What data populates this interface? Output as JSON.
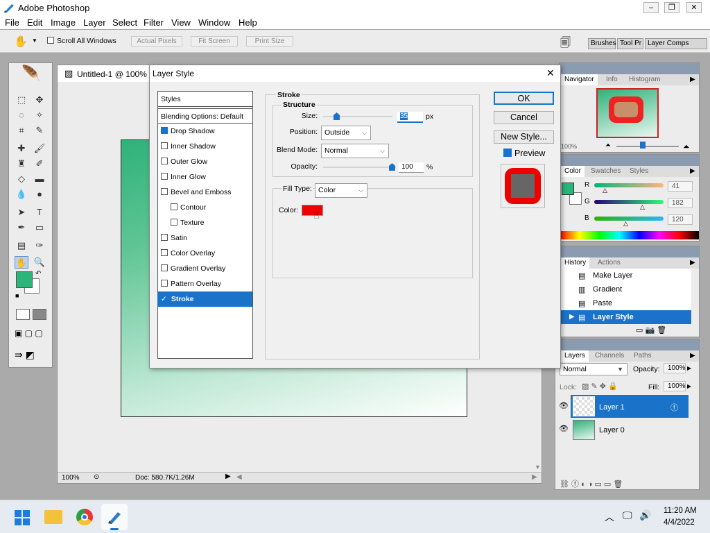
{
  "app": {
    "title": "Adobe Photoshop",
    "min": "–",
    "restore": "❐",
    "close": "✕"
  },
  "menu": [
    "File",
    "Edit",
    "Image",
    "Layer",
    "Select",
    "Filter",
    "View",
    "Window",
    "Help"
  ],
  "options": {
    "scroll_all": "Scroll All Windows",
    "actual_pixels": "Actual Pixels",
    "fit_screen": "Fit Screen",
    "print_size": "Print Size"
  },
  "workspace_tabs": [
    "Brushes",
    "Tool Pr",
    "Layer Comps"
  ],
  "document": {
    "title": "Untitled-1 @ 100% (",
    "zoom": "100%",
    "doc_info": "Doc: 580.7K/1.26M"
  },
  "navigator": {
    "tabs": [
      "Navigator",
      "Info",
      "Histogram"
    ],
    "zoom": "100%"
  },
  "color_panel": {
    "tabs": [
      "Color",
      "Swatches",
      "Styles"
    ],
    "r_label": "R",
    "g_label": "G",
    "b_label": "B",
    "r": "41",
    "g": "182",
    "b": "120",
    "fg": "#29b678"
  },
  "history": {
    "tabs": [
      "History",
      "Actions"
    ],
    "items": [
      "Make Layer",
      "Gradient",
      "Paste",
      "Layer Style"
    ]
  },
  "layers": {
    "tabs": [
      "Layers",
      "Channels",
      "Paths"
    ],
    "blend": "Normal",
    "opacity_label": "Opacity:",
    "opacity": "100%",
    "lock_label": "Lock:",
    "fill_label": "Fill:",
    "fill": "100%",
    "items": [
      "Layer 1",
      "Layer 0"
    ]
  },
  "dialog": {
    "title": "Layer Style",
    "close": "✕",
    "styles_header": "Styles",
    "blending_options": "Blending Options: Default",
    "styles": [
      {
        "label": "Drop Shadow",
        "checked": true
      },
      {
        "label": "Inner Shadow",
        "checked": false
      },
      {
        "label": "Outer Glow",
        "checked": false
      },
      {
        "label": "Inner Glow",
        "checked": false
      },
      {
        "label": "Bevel and Emboss",
        "checked": false
      },
      {
        "label": "Contour",
        "checked": false
      },
      {
        "label": "Texture",
        "checked": false
      },
      {
        "label": "Satin",
        "checked": false
      },
      {
        "label": "Color Overlay",
        "checked": false
      },
      {
        "label": "Gradient Overlay",
        "checked": false
      },
      {
        "label": "Pattern Overlay",
        "checked": false
      },
      {
        "label": "Stroke",
        "checked": true
      }
    ],
    "stroke_title": "Stroke",
    "structure_title": "Structure",
    "size_label": "Size:",
    "size_value": "35",
    "size_unit": "px",
    "position_label": "Position:",
    "position_value": "Outside",
    "blend_label": "Blend Mode:",
    "blend_value": "Normal",
    "opacity_label": "Opacity:",
    "opacity_value": "100",
    "opacity_unit": "%",
    "fill_type_label": "Fill Type:",
    "fill_type_value": "Color",
    "color_label": "Color:",
    "stroke_color": "#ee0000",
    "ok": "OK",
    "cancel": "Cancel",
    "new_style": "New Style...",
    "preview": "Preview"
  },
  "taskbar": {
    "time": "11:20 AM",
    "date": "4/4/2022"
  }
}
